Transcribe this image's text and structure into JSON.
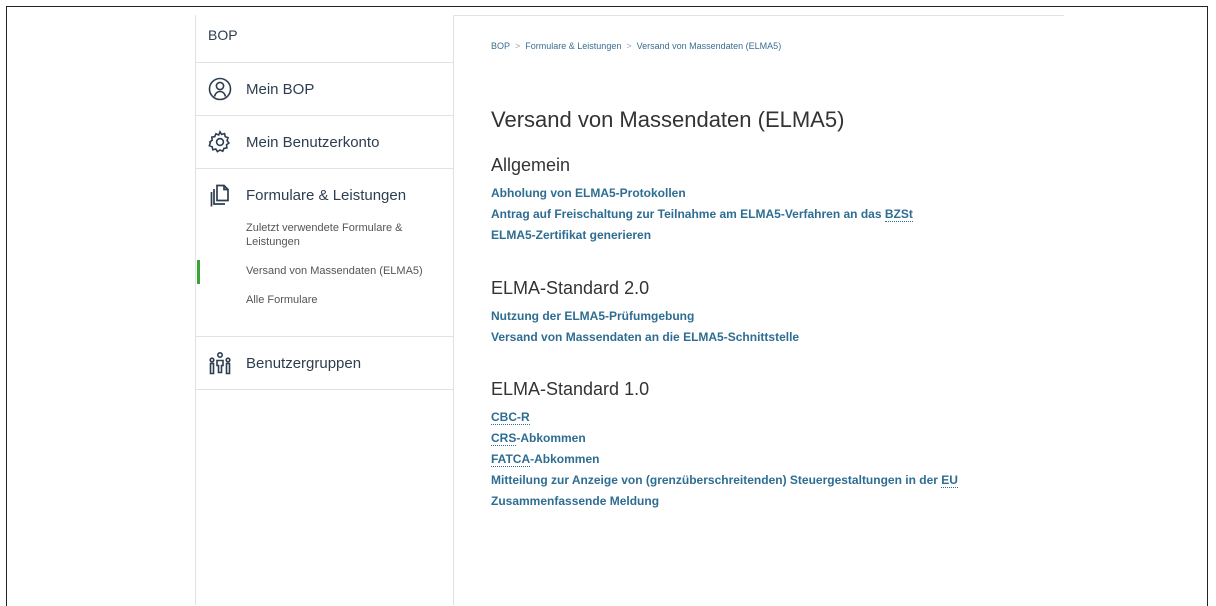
{
  "sidebar": {
    "top_label": "BOP",
    "items": [
      {
        "label": "Mein BOP"
      },
      {
        "label": "Mein Benutzerkonto"
      },
      {
        "label": "Formulare & Leistungen"
      },
      {
        "label": "Benutzergruppen"
      }
    ],
    "sub_items": [
      {
        "label": "Zuletzt verwendete Formulare & Leistungen"
      },
      {
        "label": "Versand von Massendaten (ELMA5)"
      },
      {
        "label": "Alle Formulare"
      }
    ]
  },
  "breadcrumb": {
    "items": [
      "BOP",
      "Formulare & Leistungen",
      "Versand von Massendaten (ELMA5)"
    ],
    "separator": ">"
  },
  "page_title": "Versand von Massendaten (ELMA5)",
  "sections": [
    {
      "heading": "Allgemein",
      "links": [
        {
          "text": "Abholung von ELMA5-Protokollen"
        },
        {
          "pre": "Antrag auf Freischaltung zur Teilnahme am ELMA5-Verfahren an das ",
          "abbr": "BZSt"
        },
        {
          "text": "ELMA5-Zertifikat generieren"
        }
      ]
    },
    {
      "heading": "ELMA-Standard 2.0",
      "links": [
        {
          "text": "Nutzung der ELMA5-Prüfumgebung"
        },
        {
          "text": "Versand von Massendaten an die ELMA5-Schnittstelle"
        }
      ]
    },
    {
      "heading": "ELMA-Standard 1.0",
      "links": [
        {
          "abbr": "CBC-R"
        },
        {
          "abbr": "CRS",
          "post": "-Abkommen"
        },
        {
          "abbr": "FATCA",
          "post": "-Abkommen"
        },
        {
          "pre": "Mitteilung zur Anzeige von (grenzüberschreitenden) Steuergestaltungen in der ",
          "abbr": "EU"
        },
        {
          "text": "Zusammenfassende Meldung"
        }
      ]
    }
  ],
  "colors": {
    "link": "#2e6d92",
    "active_indicator": "#3aa43a",
    "icon": "#2d3e50"
  }
}
